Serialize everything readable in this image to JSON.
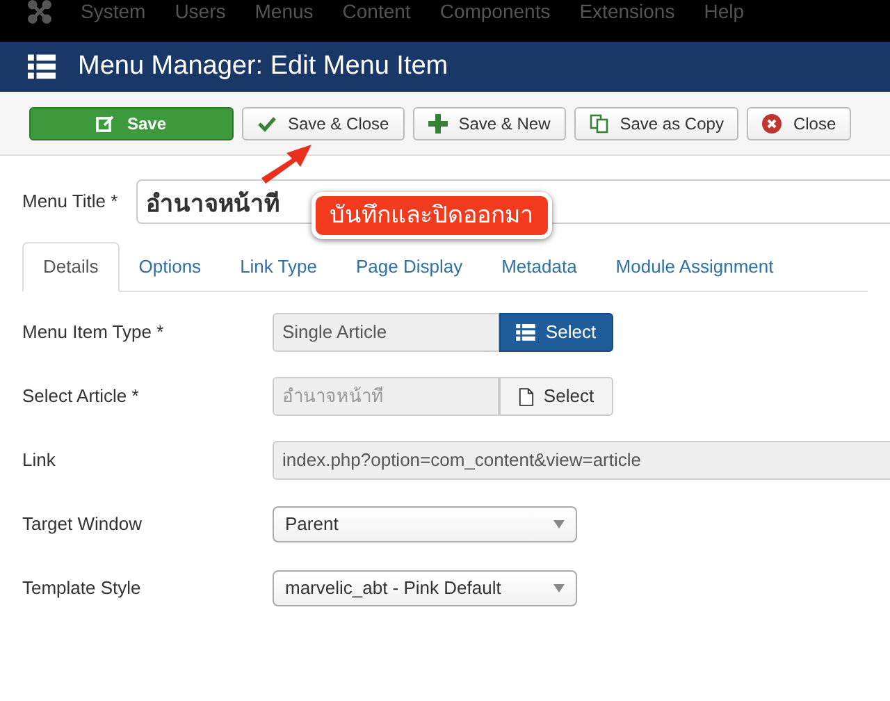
{
  "top_menu": [
    "System",
    "Users",
    "Menus",
    "Content",
    "Components",
    "Extensions",
    "Help"
  ],
  "title_bar": {
    "title": "Menu Manager: Edit Menu Item"
  },
  "toolbar": [
    {
      "label": "Save",
      "kind": "primary"
    },
    {
      "label": "Save & Close",
      "kind": "default"
    },
    {
      "label": "Save & New",
      "kind": "default"
    },
    {
      "label": "Save as Copy",
      "kind": "default"
    },
    {
      "label": "Close",
      "kind": "default"
    }
  ],
  "menu_title": {
    "label": "Menu Title *",
    "value": "อำนาจหน้าที"
  },
  "annotation": {
    "text": "บันทึกและปิดออกมา"
  },
  "tabs": [
    {
      "label": "Details",
      "selected": true
    },
    {
      "label": "Options",
      "selected": false
    },
    {
      "label": "Link Type",
      "selected": false
    },
    {
      "label": "Page Display",
      "selected": false
    },
    {
      "label": "Metadata",
      "selected": false
    },
    {
      "label": "Module Assignment",
      "selected": false
    }
  ],
  "fields": [
    {
      "kind": "picker",
      "label": "Menu Item Type *",
      "value": "Single Article",
      "button": "Select",
      "primary": true
    },
    {
      "kind": "picker",
      "label": "Select Article *",
      "value": "อำนาจหน้าที",
      "button": "Select",
      "primary": false
    },
    {
      "kind": "text",
      "label": "Link",
      "value": "index.php?option=com_content&view=article"
    },
    {
      "kind": "select",
      "label": "Target Window",
      "value": "Parent"
    },
    {
      "kind": "select",
      "label": "Template Style",
      "value": "marvelic_abt - Pink Default"
    }
  ]
}
